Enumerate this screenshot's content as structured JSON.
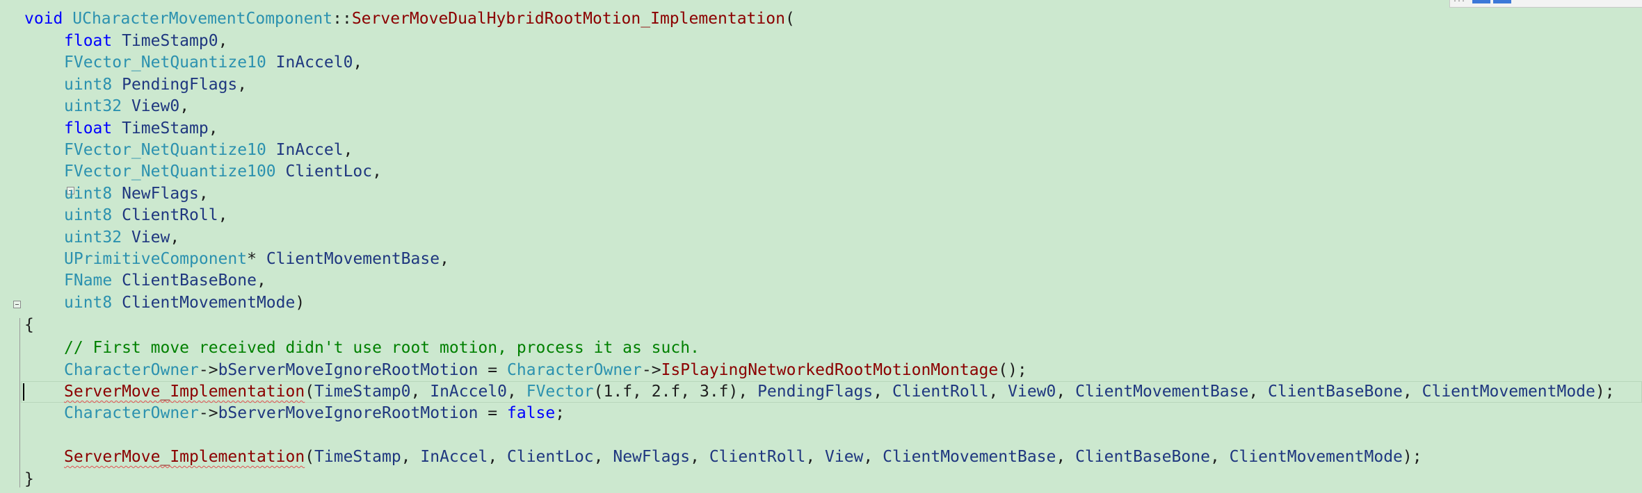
{
  "code": {
    "signature": {
      "return_type": "void",
      "class_name": "UCharacterMovementComponent",
      "scope": "::",
      "function_name": "ServerMoveDualHybridRootMotion_Implementation",
      "open_paren": "("
    },
    "params": [
      {
        "type": "float",
        "name": " TimeStamp0",
        "sep": ","
      },
      {
        "type": "FVector_NetQuantize10",
        "name": " InAccel0",
        "sep": ","
      },
      {
        "type": "uint8",
        "name": " PendingFlags",
        "sep": ","
      },
      {
        "type": "uint32",
        "name": " View0",
        "sep": ","
      },
      {
        "type": "float",
        "name": " TimeStamp",
        "sep": ","
      },
      {
        "type": "FVector_NetQuantize10",
        "name": " InAccel",
        "sep": ","
      },
      {
        "type": "FVector_NetQuantize100",
        "name": " ClientLoc",
        "sep": ","
      },
      {
        "type": "uint8",
        "name": " NewFlags",
        "sep": ","
      },
      {
        "type": "uint8",
        "name": " ClientRoll",
        "sep": ","
      },
      {
        "type": "uint32",
        "name": " View",
        "sep": ","
      },
      {
        "type": "UPrimitiveComponent",
        "ptr": "*",
        "name": " ClientMovementBase",
        "sep": ","
      },
      {
        "type": "FName",
        "name": " ClientBaseBone",
        "sep": ","
      },
      {
        "type": "uint8",
        "name": " ClientMovementMode",
        "sep": ")"
      }
    ],
    "open_brace": "{",
    "close_brace": "}",
    "comment": "// First move received didn't use root motion, process it as such.",
    "line_ignore_set": {
      "owner": "CharacterOwner",
      "arrow": "->",
      "member": "bServerMoveIgnoreRootMotion",
      "assign": " = ",
      "owner2": "CharacterOwner",
      "arrow2": "->",
      "call": "IsPlayingNetworkedRootMotionMontage",
      "end": "();"
    },
    "line_first_call": {
      "fn": "ServerMove_Implementation",
      "open": "(",
      "a1": "TimeStamp0",
      "s1": ", ",
      "a2": "InAccel0",
      "s2": ", ",
      "vec_type": "FVector",
      "vec_args": "(1.f, 2.f, 3.f)",
      "s3": ", ",
      "a4": "PendingFlags",
      "s4": ", ",
      "a5": "ClientRoll",
      "s5": ", ",
      "a6": "View0",
      "s6": ", ",
      "a7": "ClientMovementBase",
      "s7": ", ",
      "a8": "ClientBaseBone",
      "s8": ", ",
      "a9": "ClientMovementMode",
      "end": ");"
    },
    "line_reset": {
      "owner": "CharacterOwner",
      "arrow": "->",
      "member": "bServerMoveIgnoreRootMotion",
      "assign": " = ",
      "value": "false",
      "end": ";"
    },
    "line_second_call": {
      "fn": "ServerMove_Implementation",
      "open": "(",
      "a1": "TimeStamp",
      "s1": ", ",
      "a2": "InAccel",
      "s2": ", ",
      "a3": "ClientLoc",
      "s3": ", ",
      "a4": "NewFlags",
      "s4": ", ",
      "a5": "ClientRoll",
      "s5": ", ",
      "a6": "View",
      "s6": ", ",
      "a7": "ClientMovementBase",
      "s7": ", ",
      "a8": "ClientBaseBone",
      "s8": ", ",
      "a9": "ClientMovementMode",
      "end": ");"
    }
  },
  "corner_indicator": "...",
  "colors": {
    "background": "#cce8cf",
    "keyword": "#0000ff",
    "type": "#2b91af",
    "function": "#8b0000",
    "identifier": "#1f377f",
    "comment": "#008000"
  }
}
